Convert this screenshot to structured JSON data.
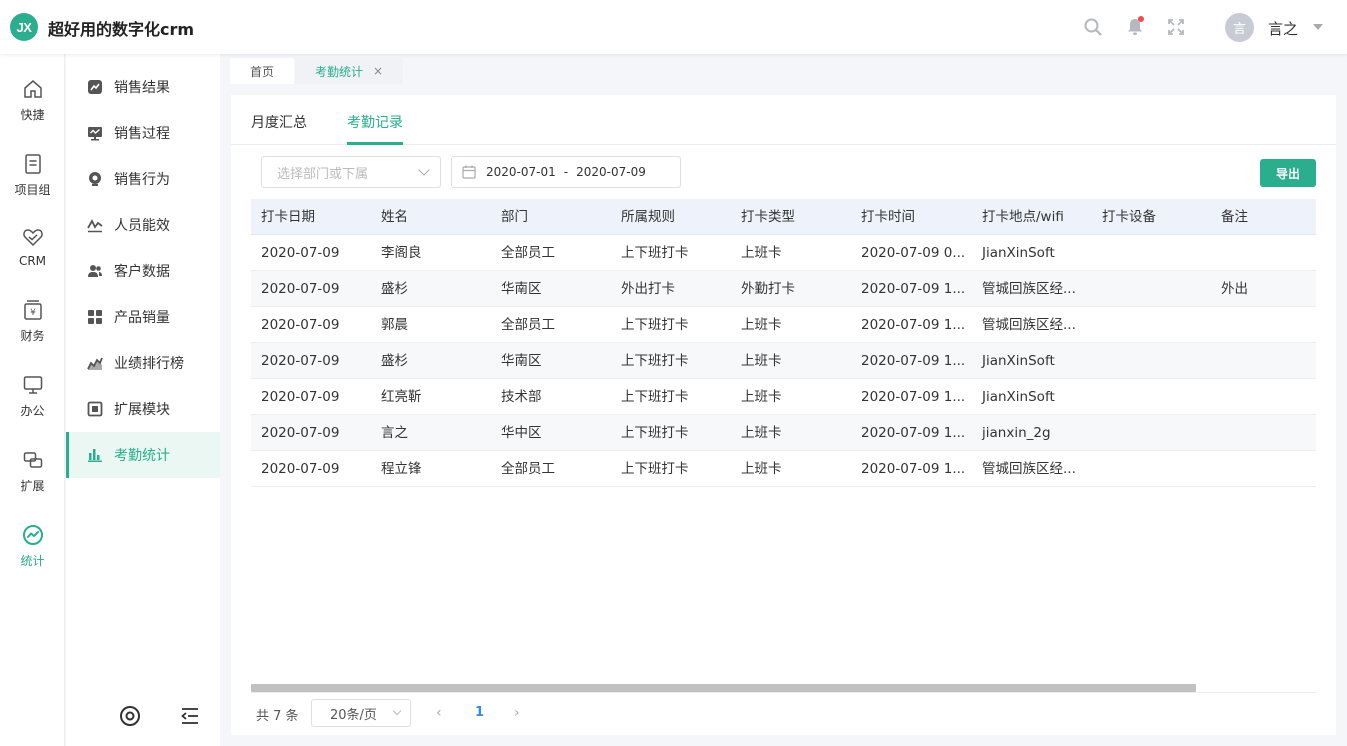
{
  "header": {
    "logo_text": "JX",
    "app_title": "超好用的数字化crm",
    "avatar_text": "言",
    "user_name": "言之",
    "icons": [
      "search-icon",
      "bell-icon",
      "fullscreen-icon",
      "chevron-down-icon"
    ],
    "accent_color": "#2aae8d",
    "notify_color": "#f24b4b"
  },
  "rail": {
    "items": [
      {
        "label": "快捷",
        "icon": "home-icon"
      },
      {
        "label": "项目组",
        "icon": "document-icon"
      },
      {
        "label": "CRM",
        "icon": "handshake-heart-icon"
      },
      {
        "label": "财务",
        "icon": "finance-icon"
      },
      {
        "label": "办公",
        "icon": "monitor-icon"
      },
      {
        "label": "扩展",
        "icon": "extend-icon"
      },
      {
        "label": "统计",
        "icon": "stats-icon",
        "active": true
      }
    ]
  },
  "subnav": {
    "items": [
      {
        "label": "销售结果",
        "icon": "sales-result-icon"
      },
      {
        "label": "销售过程",
        "icon": "sales-process-icon"
      },
      {
        "label": "销售行为",
        "icon": "sales-behavior-icon"
      },
      {
        "label": "人员能效",
        "icon": "efficiency-icon"
      },
      {
        "label": "客户数据",
        "icon": "customer-icon"
      },
      {
        "label": "产品销量",
        "icon": "product-icon"
      },
      {
        "label": "业绩排行榜",
        "icon": "ranking-icon"
      },
      {
        "label": "扩展模块",
        "icon": "module-icon"
      },
      {
        "label": "考勤统计",
        "icon": "attendance-icon",
        "active": true
      }
    ]
  },
  "tabs": [
    {
      "label": "首页"
    },
    {
      "label": "考勤统计",
      "active": true,
      "close": "×"
    }
  ],
  "inner_tabs": [
    {
      "label": "月度汇总"
    },
    {
      "label": "考勤记录",
      "active": true
    }
  ],
  "filters": {
    "dept_placeholder": "选择部门或下属",
    "date_start": "2020-07-01",
    "date_sep": "-",
    "date_end": "2020-07-09",
    "export_label": "导出"
  },
  "table": {
    "columns": [
      "打卡日期",
      "姓名",
      "部门",
      "所属规则",
      "打卡类型",
      "打卡时间",
      "打卡地点/wifi",
      "打卡设备",
      "备注"
    ],
    "rows": [
      [
        "2020-07-09",
        "李阁良",
        "全部员工",
        "上下班打卡",
        "上班卡",
        "2020-07-09 0...",
        "JianXinSoft",
        "",
        ""
      ],
      [
        "2020-07-09",
        "盛杉",
        "华南区",
        "外出打卡",
        "外勤打卡",
        "2020-07-09 1...",
        "管城回族区经...",
        "",
        "外出"
      ],
      [
        "2020-07-09",
        "郭晨",
        "全部员工",
        "上下班打卡",
        "上班卡",
        "2020-07-09 1...",
        "管城回族区经...",
        "",
        ""
      ],
      [
        "2020-07-09",
        "盛杉",
        "华南区",
        "上下班打卡",
        "上班卡",
        "2020-07-09 1...",
        "JianXinSoft",
        "",
        ""
      ],
      [
        "2020-07-09",
        "红亮靳",
        "技术部",
        "上下班打卡",
        "上班卡",
        "2020-07-09 1...",
        "JianXinSoft",
        "",
        ""
      ],
      [
        "2020-07-09",
        "言之",
        "华中区",
        "上下班打卡",
        "上班卡",
        "2020-07-09 1...",
        "jianxin_2g",
        "",
        ""
      ],
      [
        "2020-07-09",
        "程立锋",
        "全部员工",
        "上下班打卡",
        "上班卡",
        "2020-07-09 1...",
        "管城回族区经...",
        "",
        ""
      ]
    ]
  },
  "pager": {
    "total": "共 7 条",
    "page_size": "20条/页",
    "prev": "‹",
    "page": "1",
    "next": "›"
  }
}
